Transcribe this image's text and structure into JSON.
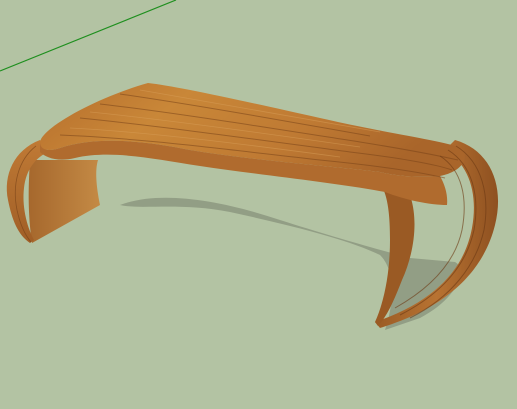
{
  "scene": {
    "background_color": "#b3c3a3",
    "axis_color": "#1e8f1e",
    "model": {
      "object": "curved-wooden-coffee-table",
      "wood_light": "#c47d35",
      "wood_mid": "#a9652a",
      "wood_dark": "#7a4419",
      "shadow_color": "#8e9a82"
    }
  }
}
